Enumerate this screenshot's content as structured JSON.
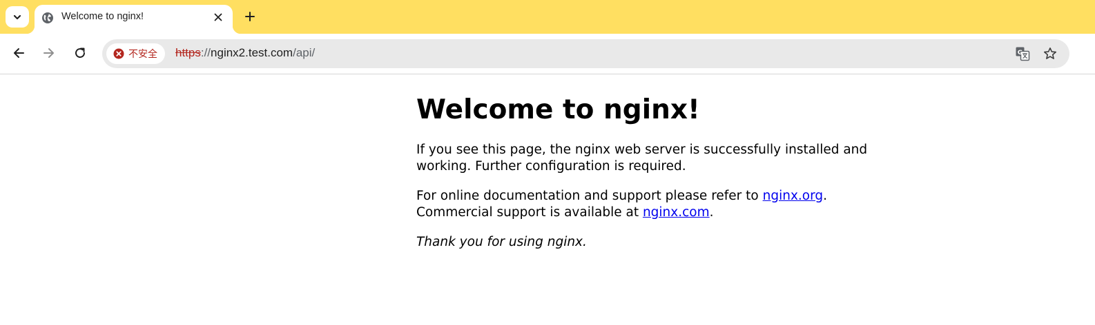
{
  "browser": {
    "tab": {
      "title": "Welcome to nginx!",
      "favicon": "globe-icon"
    },
    "toolbar": {
      "security_label": "不安全",
      "url": {
        "scheme": "https",
        "separator": "://",
        "host": "nginx2.test.com",
        "path": "/api/"
      }
    },
    "colors": {
      "tabstrip": "#ffdf61",
      "warning": "#b3261e",
      "link": "#0000ee"
    }
  },
  "page": {
    "heading": "Welcome to nginx!",
    "para1": "If you see this page, the nginx web server is successfully installed and working. Further configuration is required.",
    "para2": {
      "text1": "For online documentation and support please refer to ",
      "link1": "nginx.org",
      "text2": ".",
      "text3": "Commercial support is available at ",
      "link2": "nginx.com",
      "text4": "."
    },
    "para3": "Thank you for using nginx."
  }
}
